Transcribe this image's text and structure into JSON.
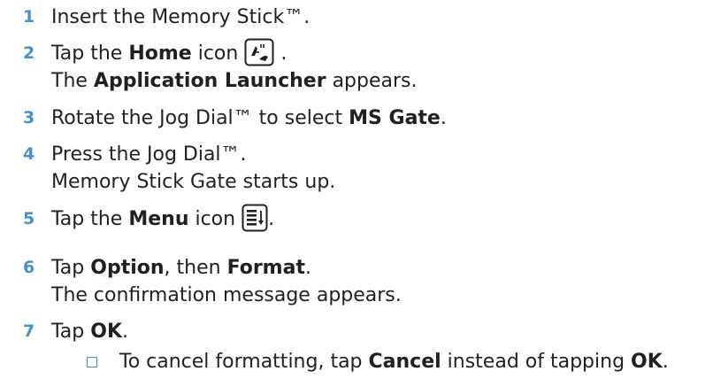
{
  "steps": [
    {
      "number": "1",
      "parts": [
        "Insert the Memory Stick™."
      ]
    },
    {
      "number": "2",
      "pre": "Tap the ",
      "bold": "Home",
      "post": " icon",
      "icon": "home-icon",
      "after_icon": " .",
      "line2_bold": "Application Launcher",
      "line2_post": " appears.",
      "line2_pre": "The "
    },
    {
      "number": "3",
      "pre": "Rotate the Jog Dial™ to select ",
      "bold": "MS Gate",
      "post": "."
    },
    {
      "number": "4",
      "line1": "Press the Jog Dial™.",
      "line2": "Memory Stick Gate starts up."
    },
    {
      "number": "5",
      "pre": "Tap the ",
      "bold": "Menu",
      "post": " icon ",
      "icon": "menu-icon",
      "after_icon": "."
    },
    {
      "number": "6",
      "pre": "Tap ",
      "bold": "Option",
      "mid": ", then ",
      "bold2": "Format",
      "post": ".",
      "line2": "The confirmation message appears."
    },
    {
      "number": "7",
      "pre": "Tap ",
      "bold": "OK",
      "post": "."
    }
  ],
  "sub_bullet": {
    "pre": "To cancel formatting, tap ",
    "bold": "Cancel",
    "mid": " instead of tapping ",
    "bold2": "OK",
    "post": "."
  },
  "colors": {
    "step_number": "#4a90c8",
    "text": "#231f20"
  }
}
